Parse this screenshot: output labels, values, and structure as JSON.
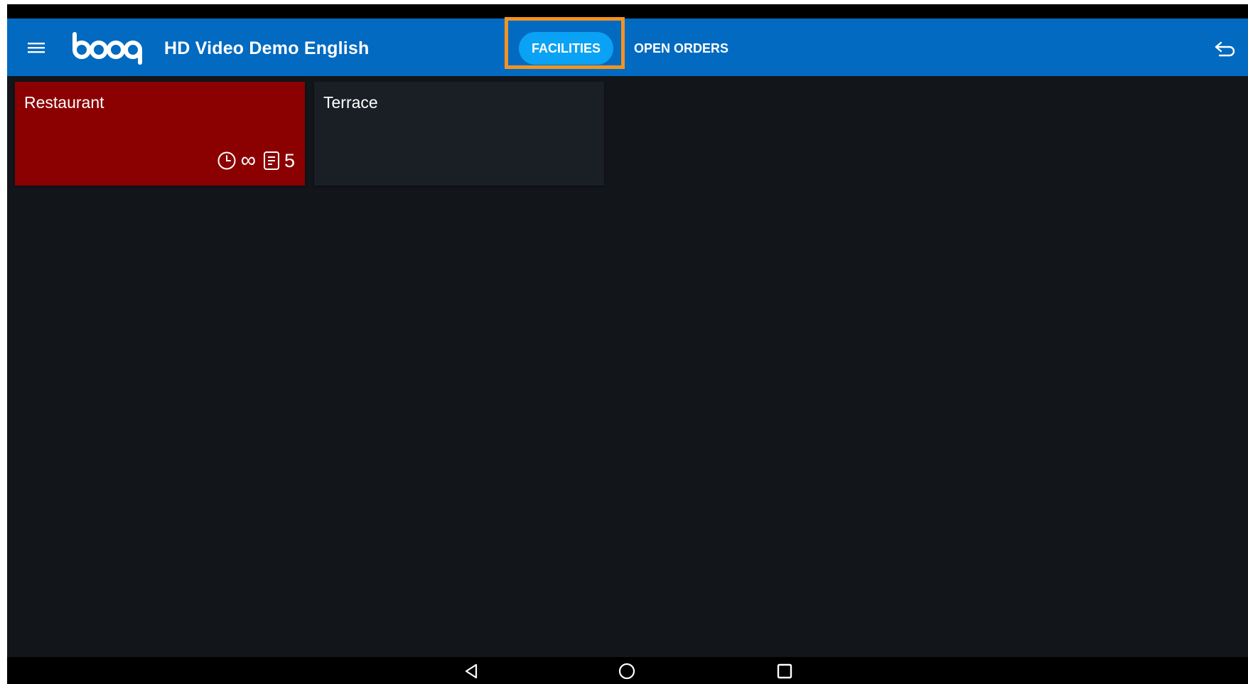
{
  "app_bar": {
    "title": "HD Video Demo English",
    "logo_text": "booq",
    "menu_icon": "menu-icon",
    "back_icon": "back-arrow-icon",
    "color": "#026ac0"
  },
  "tabs": [
    {
      "label": "FACILITIES",
      "active": true
    },
    {
      "label": "OPEN ORDERS",
      "active": false
    }
  ],
  "highlight_color": "#f39321",
  "active_tab_color": "#0aa2f4",
  "facilities": [
    {
      "name": "Restaurant",
      "color": "#8b0000",
      "time_icon": "clock-icon",
      "time_value": "∞",
      "orders_icon": "receipt-icon",
      "order_count": "5"
    },
    {
      "name": "Terrace",
      "color": "#1a1e25"
    }
  ],
  "nav_bar": {
    "buttons": [
      "back-triangle-icon",
      "home-circle-icon",
      "recents-square-icon"
    ]
  }
}
